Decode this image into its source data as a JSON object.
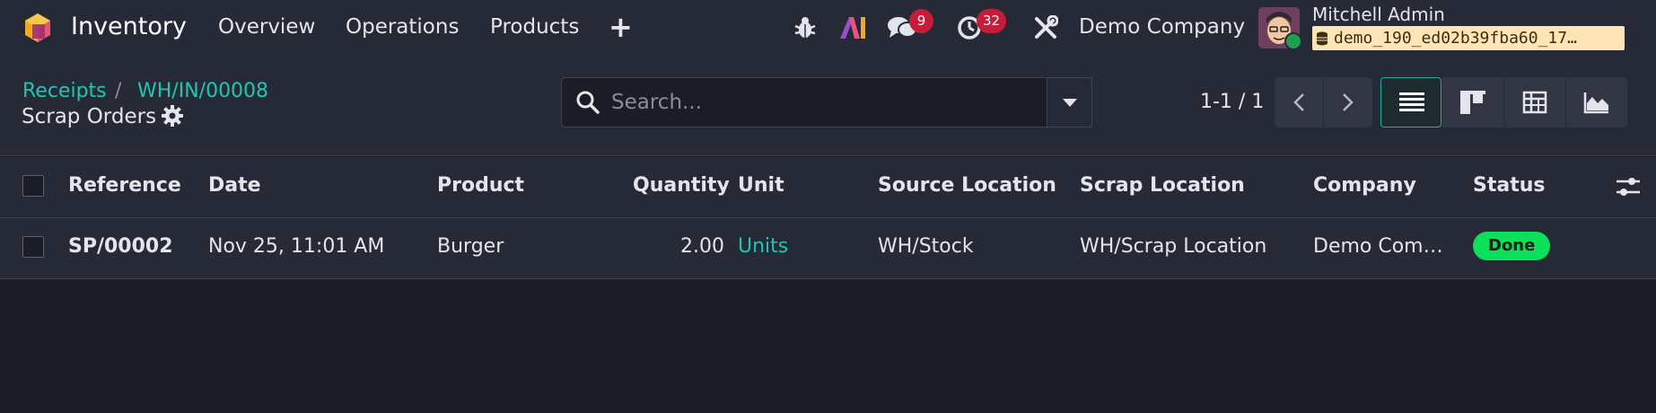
{
  "navbar": {
    "app_name": "Inventory",
    "menu": [
      "Overview",
      "Operations",
      "Products"
    ],
    "plus_label": "+",
    "messages_count": "9",
    "activities_count": "32",
    "company": "Demo Company",
    "user_name": "Mitchell Admin",
    "database": "demo_190_ed02b39fba60_17…"
  },
  "breadcrumb": {
    "parent": "Receipts",
    "separator": "/",
    "record": "WH/IN/00008",
    "title": "Scrap Orders"
  },
  "search": {
    "placeholder": "Search..."
  },
  "pager": {
    "text": "1-1 / 1"
  },
  "table": {
    "columns": [
      "Reference",
      "Date",
      "Product",
      "Quantity",
      "Unit",
      "Source Location",
      "Scrap Location",
      "Company",
      "Status"
    ],
    "rows": [
      {
        "reference": "SP/00002",
        "date": "Nov 25, 11:01 AM",
        "product": "Burger",
        "quantity": "2.00",
        "unit": "Units",
        "source_location": "WH/Stock",
        "scrap_location": "WH/Scrap Location",
        "company": "Demo Com…",
        "status": "Done"
      }
    ]
  },
  "colors": {
    "accent": "#1ec7b4",
    "badge": "#c51c3a",
    "status_done": "#0be05a"
  },
  "icons": [
    "odoo-logo-icon",
    "bug-icon",
    "ai-icon",
    "chat-icon",
    "clock-icon",
    "tools-icon",
    "gear-icon",
    "search-icon",
    "caret-down-icon",
    "chevron-left-icon",
    "chevron-right-icon",
    "list-view-icon",
    "kanban-view-icon",
    "pivot-view-icon",
    "graph-view-icon",
    "column-options-icon",
    "database-icon"
  ]
}
